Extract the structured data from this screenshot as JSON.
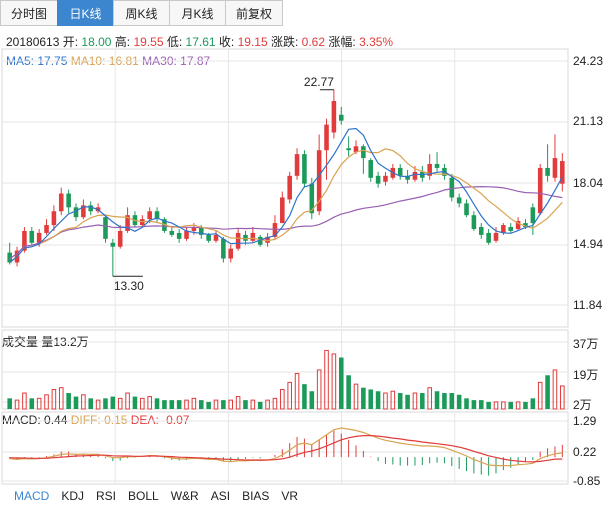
{
  "tabs": [
    {
      "label": "分时图",
      "active": false
    },
    {
      "label": "日K线",
      "active": true
    },
    {
      "label": "周K线",
      "active": false
    },
    {
      "label": "月K线",
      "active": false
    },
    {
      "label": "前复权",
      "active": false
    }
  ],
  "info": {
    "date": "20180613",
    "open_label": "开:",
    "open": "18.00",
    "high_label": "高:",
    "high": "19.55",
    "low_label": "低:",
    "low": "17.61",
    "close_label": "收:",
    "close": "19.15",
    "change_label": "涨跌:",
    "change": "0.62",
    "pct_label": "涨幅:",
    "pct": "3.35%"
  },
  "ma": {
    "ma5_label": "MA5:",
    "ma5": "17.75",
    "ma10_label": "MA10:",
    "ma10": "16.81",
    "ma30_label": "MA30:",
    "ma30": "17.87"
  },
  "price_axis": [
    "24.23",
    "21.13",
    "18.04",
    "14.94",
    "11.84"
  ],
  "annotations": {
    "high_mark": "22.77",
    "low_mark": "13.30"
  },
  "volume": {
    "label": "成交量",
    "value_label": "量13.2万",
    "axis": [
      "37万",
      "19万",
      "2万"
    ]
  },
  "macd": {
    "macd_label": "MACD:",
    "macd": "0.44",
    "diff_label": "DIFF:",
    "diff": "0.15",
    "dea_label": "DEA:",
    "dea": "-0.07",
    "axis": [
      "1.29",
      "0.22",
      "-0.85"
    ]
  },
  "indicator_tabs": [
    {
      "label": "MACD",
      "active": true
    },
    {
      "label": "KDJ",
      "active": false
    },
    {
      "label": "RSI",
      "active": false
    },
    {
      "label": "BOLL",
      "active": false
    },
    {
      "label": "W&R",
      "active": false
    },
    {
      "label": "ASI",
      "active": false
    },
    {
      "label": "BIAS",
      "active": false
    },
    {
      "label": "VR",
      "active": false
    }
  ],
  "colors": {
    "up": "#e23b3b",
    "down": "#1b9a5a",
    "ma5": "#2f73c9",
    "ma10": "#d9a350",
    "ma30": "#9a5fb3",
    "accent": "#3b86cf",
    "grid": "#e6e6e6"
  },
  "chart_data": {
    "type": "candlestick",
    "price_range": [
      11.84,
      24.23
    ],
    "volume_range_wan": [
      0,
      40
    ],
    "macd_range": [
      -0.85,
      1.29
    ],
    "candles": [
      [
        14.5,
        14.0,
        15.0,
        13.9
      ],
      [
        14.0,
        14.6,
        14.8,
        13.8
      ],
      [
        14.6,
        15.6,
        15.8,
        14.5
      ],
      [
        15.6,
        15.0,
        15.8,
        14.9
      ],
      [
        15.0,
        15.5,
        15.7,
        14.8
      ],
      [
        15.5,
        15.9,
        16.2,
        15.4
      ],
      [
        15.9,
        16.6,
        16.9,
        15.6
      ],
      [
        16.6,
        17.5,
        17.8,
        16.4
      ],
      [
        17.5,
        16.8,
        17.7,
        16.5
      ],
      [
        16.8,
        16.3,
        17.0,
        16.1
      ],
      [
        16.3,
        16.9,
        17.2,
        16.2
      ],
      [
        16.9,
        16.6,
        17.1,
        16.4
      ],
      [
        16.6,
        16.8,
        17.0,
        16.5
      ],
      [
        16.3,
        15.2,
        16.4,
        15.0
      ],
      [
        15.0,
        14.8,
        15.2,
        13.3
      ],
      [
        14.8,
        15.6,
        15.9,
        14.7
      ],
      [
        15.6,
        16.4,
        16.8,
        15.5
      ],
      [
        16.4,
        15.9,
        16.6,
        15.8
      ],
      [
        15.9,
        16.2,
        16.4,
        15.8
      ],
      [
        16.2,
        16.6,
        16.8,
        16.0
      ],
      [
        16.6,
        16.2,
        16.8,
        16.0
      ],
      [
        16.2,
        15.6,
        16.3,
        15.5
      ],
      [
        15.6,
        15.4,
        15.8,
        15.3
      ],
      [
        15.5,
        15.2,
        15.7,
        15.0
      ],
      [
        15.2,
        15.6,
        15.8,
        15.1
      ],
      [
        15.6,
        15.8,
        16.0,
        15.4
      ],
      [
        15.8,
        15.4,
        15.9,
        15.2
      ],
      [
        15.4,
        15.1,
        15.5,
        15.0
      ],
      [
        15.1,
        15.4,
        15.6,
        15.0
      ],
      [
        15.2,
        14.2,
        15.3,
        14.0
      ],
      [
        14.2,
        14.7,
        14.9,
        14.0
      ],
      [
        14.7,
        15.5,
        15.7,
        14.6
      ],
      [
        15.4,
        15.1,
        15.6,
        14.9
      ],
      [
        15.1,
        15.5,
        15.8,
        15.0
      ],
      [
        15.3,
        14.9,
        15.4,
        14.8
      ],
      [
        15.0,
        15.3,
        15.5,
        14.8
      ],
      [
        15.3,
        16.0,
        16.4,
        15.2
      ],
      [
        16.0,
        17.3,
        17.6,
        16.0
      ],
      [
        17.2,
        18.4,
        18.6,
        17.0
      ],
      [
        18.4,
        19.5,
        19.8,
        18.2
      ],
      [
        19.5,
        18.0,
        19.7,
        17.8
      ],
      [
        18.0,
        16.5,
        18.3,
        16.2
      ],
      [
        16.6,
        19.7,
        20.5,
        16.4
      ],
      [
        19.7,
        21.0,
        21.3,
        18.2
      ],
      [
        20.6,
        22.2,
        22.77,
        20.3
      ],
      [
        21.5,
        21.2,
        21.9,
        21.0
      ],
      [
        19.8,
        19.7,
        20.4,
        19.4
      ],
      [
        19.6,
        19.9,
        20.2,
        19.5
      ],
      [
        19.9,
        19.3,
        20.0,
        18.5
      ],
      [
        19.2,
        18.3,
        19.3,
        18.1
      ],
      [
        18.4,
        18.0,
        18.6,
        17.8
      ],
      [
        18.1,
        18.4,
        18.6,
        17.9
      ],
      [
        18.3,
        18.8,
        19.0,
        18.2
      ],
      [
        18.8,
        18.4,
        19.0,
        18.2
      ],
      [
        18.4,
        18.2,
        18.7,
        18.0
      ],
      [
        18.2,
        18.6,
        18.9,
        18.1
      ],
      [
        18.6,
        18.3,
        18.9,
        18.1
      ],
      [
        18.4,
        19.0,
        19.5,
        18.2
      ],
      [
        19.0,
        18.8,
        19.6,
        18.6
      ],
      [
        18.8,
        18.4,
        19.0,
        18.2
      ],
      [
        18.3,
        17.3,
        18.5,
        17.1
      ],
      [
        17.3,
        17.0,
        17.5,
        16.8
      ],
      [
        17.0,
        16.4,
        17.2,
        16.3
      ],
      [
        16.4,
        15.7,
        16.6,
        15.6
      ],
      [
        15.8,
        15.4,
        16.0,
        15.2
      ],
      [
        15.5,
        15.0,
        15.7,
        14.9
      ],
      [
        15.1,
        15.5,
        15.8,
        15.0
      ],
      [
        15.5,
        15.9,
        16.0,
        15.4
      ],
      [
        15.8,
        15.6,
        16.0,
        15.5
      ],
      [
        15.7,
        16.1,
        16.3,
        15.6
      ],
      [
        16.0,
        15.8,
        16.2,
        15.7
      ],
      [
        16.8,
        16.0,
        17.0,
        15.4
      ],
      [
        16.5,
        18.8,
        19.0,
        16.4
      ],
      [
        18.8,
        18.4,
        20.0,
        18.1
      ],
      [
        18.3,
        19.3,
        20.5,
        18.1
      ],
      [
        18.0,
        19.15,
        19.55,
        17.61
      ]
    ],
    "volumes_wan": [
      6,
      5,
      9,
      6,
      6,
      8,
      11,
      12,
      9,
      7,
      8,
      6,
      5,
      6,
      7,
      6,
      9,
      7,
      6,
      7,
      6,
      5,
      5,
      5,
      5,
      6,
      5,
      4,
      5,
      5,
      5,
      7,
      5,
      5,
      4,
      5,
      6,
      11,
      15,
      20,
      14,
      10,
      22,
      33,
      31,
      29,
      19,
      14,
      12,
      11,
      10,
      9,
      10,
      9,
      8,
      9,
      9,
      12,
      10,
      9,
      9,
      8,
      6,
      5,
      5,
      4,
      4,
      4,
      4,
      4,
      4,
      6,
      15,
      19,
      22,
      13
    ],
    "diff": [
      -0.05,
      -0.08,
      -0.05,
      -0.06,
      -0.05,
      -0.02,
      0.03,
      0.1,
      0.12,
      0.1,
      0.11,
      0.1,
      0.1,
      0.05,
      -0.02,
      -0.02,
      0.02,
      0.02,
      0.03,
      0.06,
      0.05,
      0.01,
      -0.03,
      -0.06,
      -0.06,
      -0.04,
      -0.05,
      -0.08,
      -0.08,
      -0.14,
      -0.16,
      -0.13,
      -0.13,
      -0.11,
      -0.12,
      -0.1,
      -0.05,
      0.08,
      0.25,
      0.45,
      0.5,
      0.45,
      0.62,
      0.8,
      0.98,
      1.04,
      1.0,
      0.95,
      0.88,
      0.78,
      0.68,
      0.6,
      0.55,
      0.5,
      0.46,
      0.43,
      0.4,
      0.4,
      0.38,
      0.34,
      0.25,
      0.15,
      0.04,
      -0.08,
      -0.18,
      -0.28,
      -0.3,
      -0.3,
      -0.3,
      -0.27,
      -0.25,
      -0.22,
      -0.05,
      0.05,
      0.12,
      0.15
    ],
    "dea": [
      -0.02,
      -0.03,
      -0.03,
      -0.04,
      -0.04,
      -0.04,
      -0.02,
      0.0,
      0.02,
      0.04,
      0.05,
      0.06,
      0.07,
      0.07,
      0.05,
      0.04,
      0.04,
      0.03,
      0.03,
      0.04,
      0.04,
      0.03,
      0.02,
      0.0,
      -0.01,
      -0.02,
      -0.03,
      -0.04,
      -0.05,
      -0.07,
      -0.08,
      -0.09,
      -0.1,
      -0.1,
      -0.1,
      -0.1,
      -0.09,
      -0.06,
      0.0,
      0.09,
      0.17,
      0.22,
      0.3,
      0.4,
      0.51,
      0.62,
      0.69,
      0.74,
      0.77,
      0.77,
      0.75,
      0.72,
      0.68,
      0.65,
      0.61,
      0.58,
      0.54,
      0.51,
      0.48,
      0.45,
      0.41,
      0.36,
      0.29,
      0.21,
      0.13,
      0.05,
      -0.01,
      -0.07,
      -0.11,
      -0.14,
      -0.16,
      -0.17,
      -0.15,
      -0.11,
      -0.07,
      -0.07
    ]
  }
}
